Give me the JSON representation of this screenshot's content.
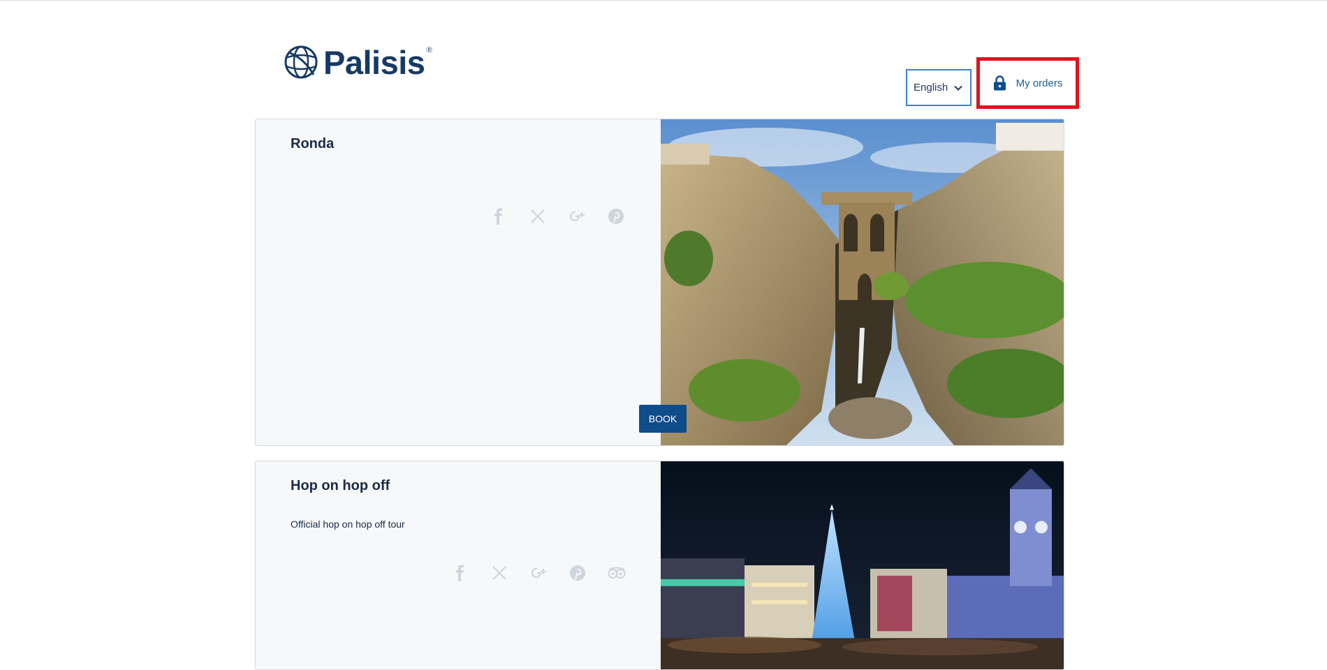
{
  "header": {
    "logo_text": "Palisis",
    "logo_reg": "®",
    "language": {
      "selected": "English",
      "icon": "chevron-down-icon"
    },
    "my_orders": {
      "label": "My orders",
      "icon": "lock-icon"
    }
  },
  "tours": [
    {
      "title": "Ronda",
      "description": "",
      "social": [
        "facebook-icon",
        "x-icon",
        "google-plus-icon",
        "pinterest-icon"
      ],
      "book_label": "BOOK",
      "image": "Ronda bridge and gorge"
    },
    {
      "title": "Hop on hop off",
      "description": "Official hop on hop off tour",
      "social": [
        "facebook-icon",
        "x-icon",
        "google-plus-icon",
        "pinterest-icon",
        "tripadvisor-icon"
      ],
      "image": "Madrid square with Christmas tree at night"
    }
  ],
  "colors": {
    "brand": "#163a66",
    "button": "#0e4c8a",
    "highlight": "#e3101d",
    "select_border": "#3f7fd6",
    "card_bg": "#f6f8fa"
  }
}
